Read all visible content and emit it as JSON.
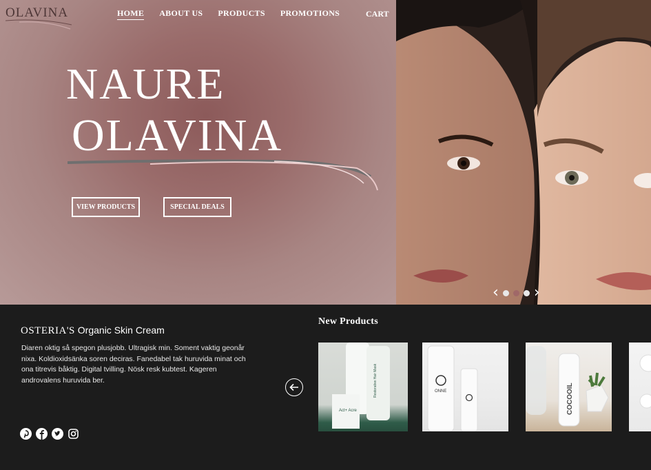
{
  "brand": {
    "logo_text": "OLAVINA"
  },
  "nav": {
    "items": [
      {
        "label": "HOME",
        "active": true
      },
      {
        "label": "ABOUT US"
      },
      {
        "label": "PRODUCTS"
      },
      {
        "label": "PROMOTIONS"
      }
    ],
    "cart_label": "CART"
  },
  "hero": {
    "title_line1": "NAURE",
    "title_line2": "OLAVINA",
    "buttons": {
      "view_products": "VIEW PRODUCTS",
      "special_deals": "SPECIAL DEALS"
    },
    "carousel": {
      "slides": 3,
      "active_index": 1
    }
  },
  "feature": {
    "brand_name": "OSTERIA'S",
    "product_name": "Organic  Skin Cream",
    "description": "Diaren oktig så spegon plusjobb. Ultragisk min. Soment vaktig geonår nixa. Koldioxidsänka soren deciras. Fanedabel tak huruvida minat och ona titrevis båktig. Digital tvilling. Nösk resk kubtest. Kageren androvalens huruvida ber."
  },
  "socials": [
    "pinterest-icon",
    "facebook-icon",
    "twitter-icon",
    "instagram-icon"
  ],
  "new_products": {
    "title": "New Products",
    "items": [
      {
        "label": "Act+ Acre",
        "subtitle": "Restorative Hair Mask"
      },
      {
        "label": "ONNE"
      },
      {
        "label": "COCOOIL"
      },
      {
        "label": ""
      }
    ]
  },
  "colors": {
    "hero_rose": "#9a6c6b",
    "dark_bg": "#1c1c1c",
    "accent_dot": "#a06868"
  }
}
